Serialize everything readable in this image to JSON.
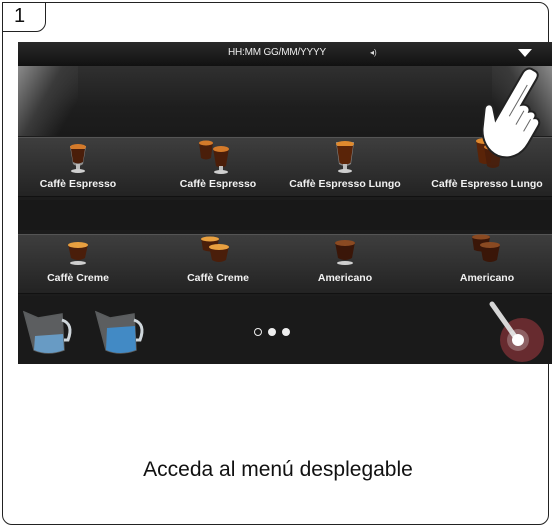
{
  "step": {
    "number": "1"
  },
  "status_bar": {
    "datetime": "HH:MM GG/MM/YYYY",
    "volume_icon": "speaker-icon",
    "menu_icon": "chevron-down-icon"
  },
  "drinks": [
    {
      "label": "Caffè Espresso",
      "icon": "single-espresso-cup-icon"
    },
    {
      "label": "Caffè Espresso",
      "icon": "double-espresso-cup-icon"
    },
    {
      "label": "Caffè Espresso Lungo",
      "icon": "single-lungo-cup-icon"
    },
    {
      "label": "Caffè Espresso Lungo",
      "icon": "double-lungo-cup-icon"
    },
    {
      "label": "Caffè Creme",
      "icon": "single-creme-cup-icon"
    },
    {
      "label": "Caffè Creme",
      "icon": "double-creme-cup-icon"
    },
    {
      "label": "Americano",
      "icon": "single-americano-cup-icon"
    },
    {
      "label": "Americano",
      "icon": "double-americano-cup-icon"
    }
  ],
  "bottom_bar": {
    "left_buttons": [
      "milk-pitcher-icon",
      "water-pitcher-icon"
    ],
    "page_indicator": {
      "current": 2,
      "total": 3
    },
    "right_button": "hot-water-spout-icon"
  },
  "pointer": "hand-pointer-icon",
  "caption": "Acceda al menú desplegable"
}
